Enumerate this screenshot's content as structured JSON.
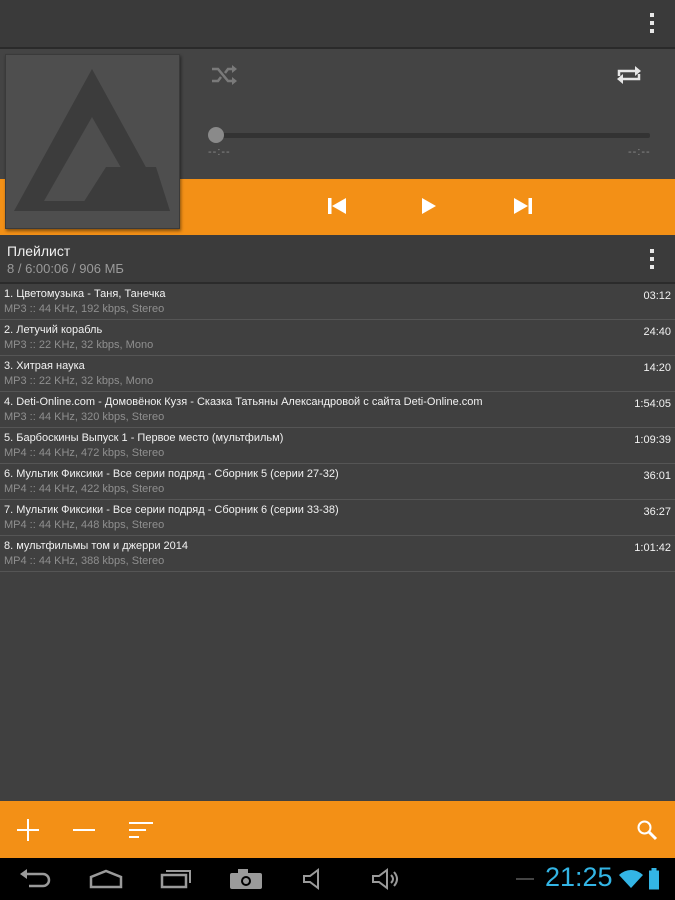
{
  "playlist": {
    "title": "Плейлист",
    "info": "8 / 6:00:06 / 906 МБ"
  },
  "player": {
    "position": "--:--",
    "duration": "--:--",
    "progress": 0
  },
  "tracks": [
    {
      "title": "1. Цветомузыка - Таня, Танечка",
      "info": "MP3 :: 44 KHz, 192 kbps, Stereo",
      "duration": "03:12"
    },
    {
      "title": "2. Летучий корабль",
      "info": "MP3 :: 22 KHz, 32 kbps, Mono",
      "duration": "24:40"
    },
    {
      "title": "3. Хитрая наука",
      "info": "MP3 :: 22 KHz, 32 kbps, Mono",
      "duration": "14:20"
    },
    {
      "title": "4. Deti-Online.com - Домовёнок Кузя - Сказка Татьяны Александровой с сайта Deti-Online.com",
      "info": "MP3 :: 44 KHz, 320 kbps, Stereo",
      "duration": "1:54:05"
    },
    {
      "title": "5. Барбоскины Выпуск 1 - Первое место (мультфильм)",
      "info": "MP4 :: 44 KHz, 472 kbps, Stereo",
      "duration": "1:09:39"
    },
    {
      "title": "6. Мультик Фиксики - Все серии подряд - Сборник 5 (серии 27-32)",
      "info": "MP4 :: 44 KHz, 422 kbps, Stereo",
      "duration": "36:01"
    },
    {
      "title": "7. Мультик Фиксики - Все серии подряд - Сборник 6 (серии 33-38)",
      "info": "MP4 :: 44 KHz, 448 kbps, Stereo",
      "duration": "36:27"
    },
    {
      "title": "8. мультфильмы том и джерри 2014",
      "info": "MP4 :: 44 KHz, 388 kbps, Stereo",
      "duration": "1:01:42"
    }
  ],
  "status": {
    "time": "21:25"
  },
  "colors": {
    "accent": "#f39016",
    "clock": "#33b5e5",
    "background": "#404040"
  },
  "icons": {
    "overflow": "more-vert-icon",
    "shuffle": "shuffle-icon",
    "repeat": "repeat-icon",
    "previous": "skip-previous-icon",
    "play": "play-icon",
    "next": "skip-next-icon",
    "add": "add-icon",
    "remove": "remove-icon",
    "sort": "sort-icon",
    "search": "search-icon"
  }
}
